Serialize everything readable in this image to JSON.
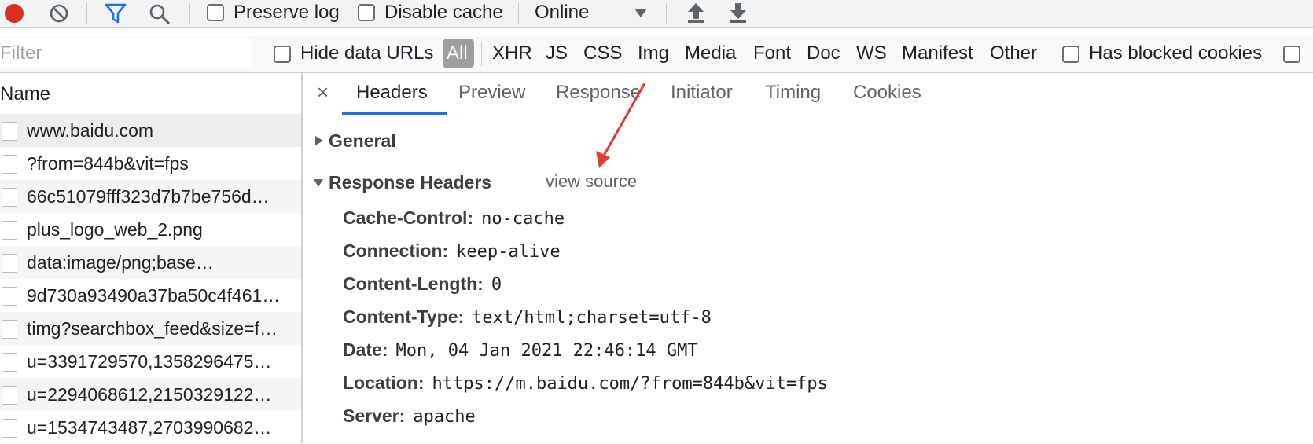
{
  "toolbar": {
    "preserve_log_label": "Preserve log",
    "disable_cache_label": "Disable cache",
    "throttling_value": "Online"
  },
  "filterbar": {
    "filter_placeholder": "Filter",
    "hide_data_urls_label": "Hide data URLs",
    "types": [
      "All",
      "XHR",
      "JS",
      "CSS",
      "Img",
      "Media",
      "Font",
      "Doc",
      "WS",
      "Manifest",
      "Other"
    ],
    "has_blocked_cookies_label": "Has blocked cookies"
  },
  "requests": {
    "column_header": "Name",
    "items": [
      {
        "name": "www.baidu.com"
      },
      {
        "name": "?from=844b&vit=fps"
      },
      {
        "name": "66c51079fff323d7b7be756d…"
      },
      {
        "name": "plus_logo_web_2.png"
      },
      {
        "name": "data:image/png;base…"
      },
      {
        "name": "9d730a93490a37ba50c4f461…"
      },
      {
        "name": "timg?searchbox_feed&size=f…"
      },
      {
        "name": "u=3391729570,1358296475…"
      },
      {
        "name": "u=2294068612,2150329122…"
      },
      {
        "name": "u=1534743487,2703990682…"
      }
    ]
  },
  "details": {
    "close_symbol": "×",
    "tabs": [
      "Headers",
      "Preview",
      "Response",
      "Initiator",
      "Timing",
      "Cookies"
    ],
    "general_label": "General",
    "response_headers_label": "Response Headers",
    "view_source_label": "view source",
    "headers": [
      {
        "key": "Cache-Control:",
        "value": "no-cache"
      },
      {
        "key": "Connection:",
        "value": "keep-alive"
      },
      {
        "key": "Content-Length:",
        "value": "0"
      },
      {
        "key": "Content-Type:",
        "value": "text/html;charset=utf-8"
      },
      {
        "key": "Date:",
        "value": "Mon, 04 Jan 2021 22:46:14 GMT"
      },
      {
        "key": "Location:",
        "value": "https://m.baidu.com/?from=844b&vit=fps"
      },
      {
        "key": "Server:",
        "value": "apache"
      }
    ]
  },
  "colors": {
    "record": "#d93025",
    "accent": "#1a73e8",
    "annotation_arrow": "#e53935"
  }
}
